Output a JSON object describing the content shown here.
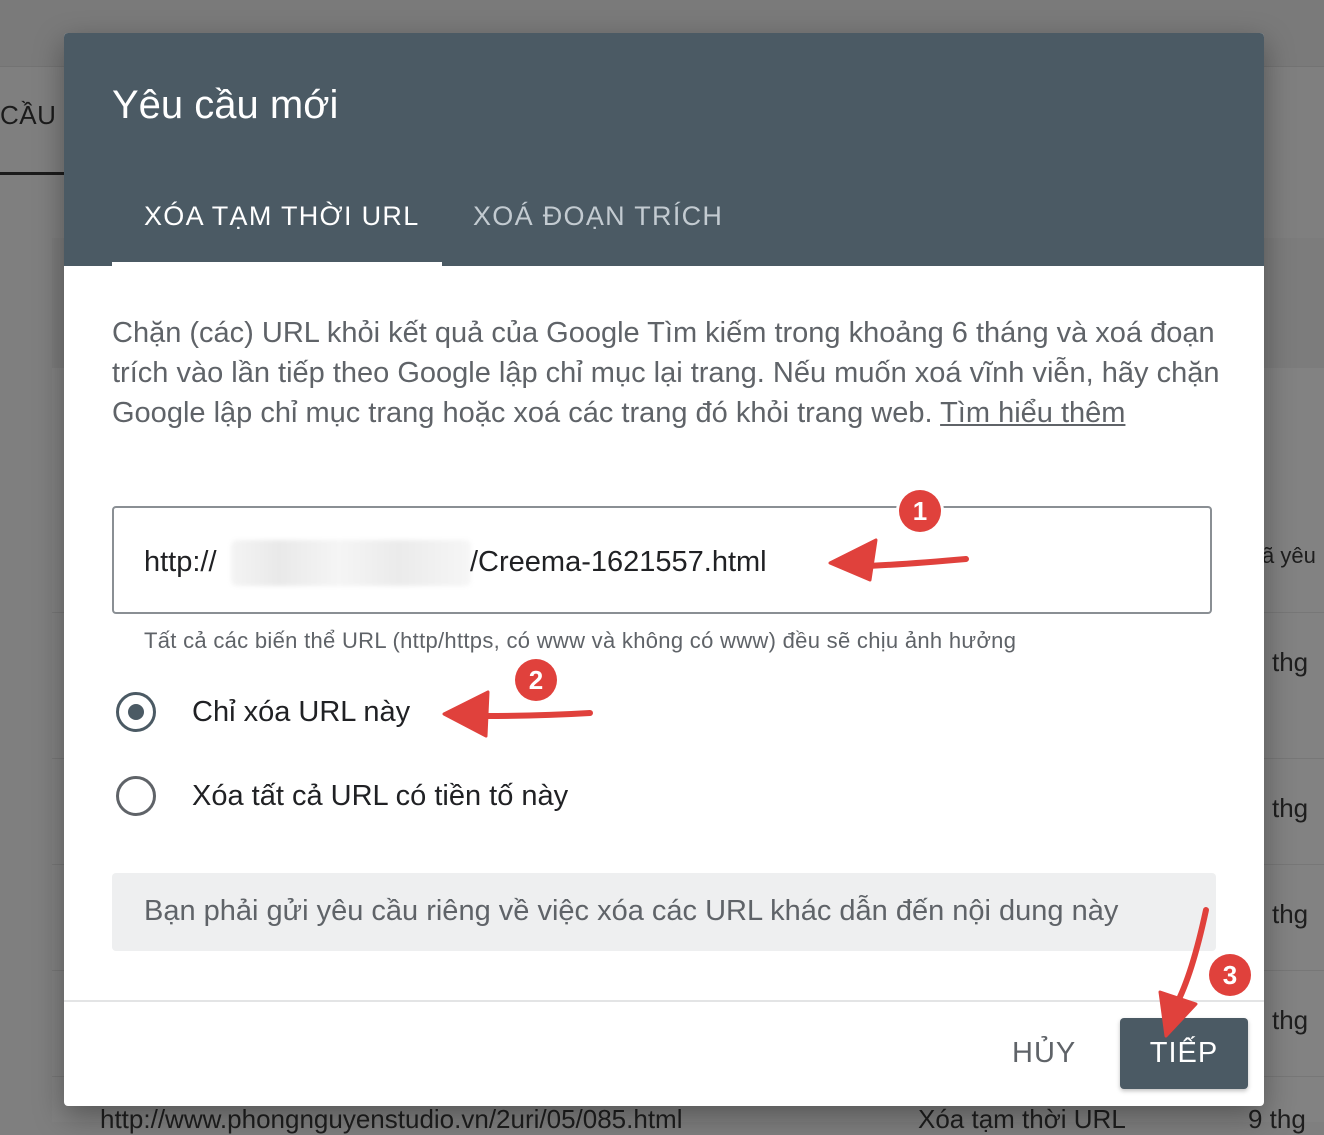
{
  "background": {
    "tab_label": "CẦU",
    "column_header": "ã yêu",
    "row_cells": [
      "thg",
      "thg",
      "thg",
      "thg"
    ],
    "bottom_url": "http://www.phongnguyenstudio.vn/2uri/05/085.html",
    "bottom_type": "Xóa tạm thời URL",
    "bottom_date": "9 thg"
  },
  "dialog": {
    "title": "Yêu cầu mới",
    "tabs": [
      {
        "label": "XÓA TẠM THỜI URL",
        "active": true
      },
      {
        "label": "XOÁ ĐOẠN TRÍCH",
        "active": false
      }
    ],
    "description": "Chặn (các) URL khỏi kết quả của Google Tìm kiếm trong khoảng 6 tháng và xoá đoạn trích vào lần tiếp theo Google lập chỉ mục lại trang. Nếu muốn xoá vĩnh viễn, hãy chặn Google lập chỉ mục trang hoặc xoá các trang đó khỏi trang web.",
    "learn_more": "Tìm hiểu thêm",
    "url_input": {
      "prefix": "http://",
      "suffix": "/Creema-1621557.html"
    },
    "helper_text": "Tất cả các biến thể URL (http/https, có www và không có www) đều sẽ chịu ảnh hưởng",
    "options": [
      {
        "label": "Chỉ xóa URL này",
        "checked": true
      },
      {
        "label": "Xóa tất cả URL có tiền tố này",
        "checked": false
      }
    ],
    "info_text": "Bạn phải gửi yêu cầu riêng về việc xóa các URL khác dẫn đến nội dung này",
    "cancel_label": "HỦY",
    "next_label": "TIẾP"
  },
  "annotations": {
    "badges": [
      "1",
      "2",
      "3"
    ],
    "color": "#e0413c"
  },
  "colors": {
    "header": "#4b5a64",
    "overlay": "#7f7f7f",
    "text_secondary": "#5f6368"
  }
}
